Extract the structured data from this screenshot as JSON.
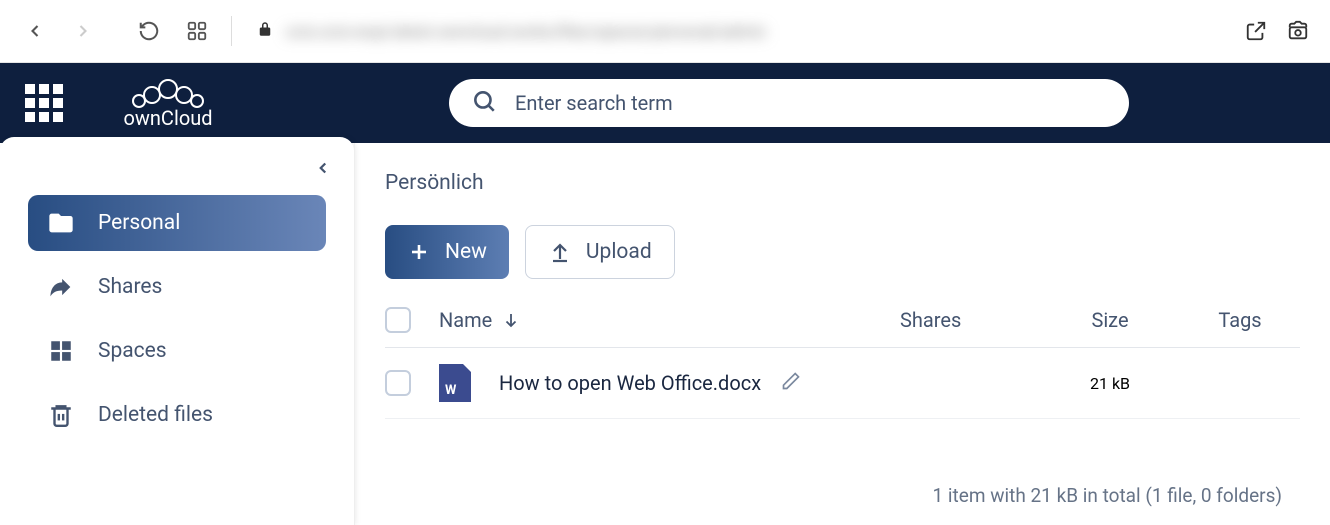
{
  "browser": {
    "url_blurred": "ocis.ocis-wopi.latest.owncloud.works/files/spaces/personal/admin"
  },
  "search": {
    "placeholder": "Enter search term"
  },
  "sidebar": {
    "items": [
      {
        "label": "Personal"
      },
      {
        "label": "Shares"
      },
      {
        "label": "Spaces"
      },
      {
        "label": "Deleted files"
      }
    ]
  },
  "main": {
    "breadcrumb": "Persönlich",
    "new_label": "New",
    "upload_label": "Upload",
    "columns": {
      "name": "Name",
      "shares": "Shares",
      "size": "Size",
      "tags": "Tags"
    },
    "rows": [
      {
        "name": "How to open Web Office.docx",
        "size": "21 kB"
      }
    ],
    "footer": "1 item with 21 kB in total (1 file, 0 folders)"
  }
}
